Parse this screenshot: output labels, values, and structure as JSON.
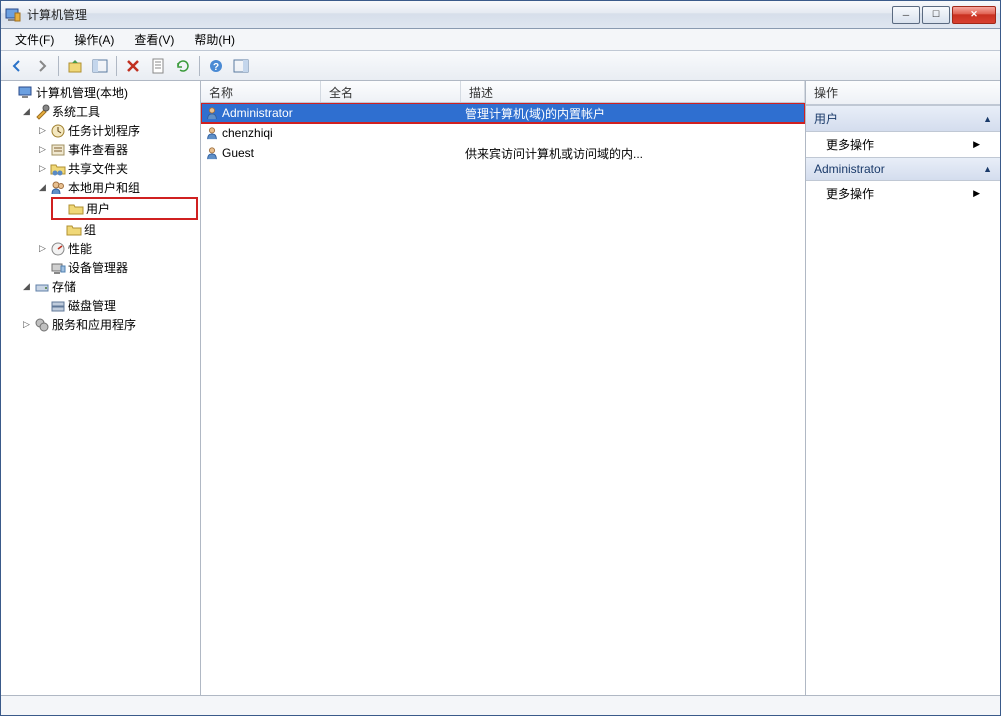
{
  "window": {
    "title": "计算机管理"
  },
  "menu": {
    "file": "文件(F)",
    "action": "操作(A)",
    "view": "查看(V)",
    "help": "帮助(H)"
  },
  "tree": {
    "root": "计算机管理(本地)",
    "system_tools": "系统工具",
    "task_scheduler": "任务计划程序",
    "event_viewer": "事件查看器",
    "shared_folders": "共享文件夹",
    "local_users_groups": "本地用户和组",
    "users": "用户",
    "groups": "组",
    "performance": "性能",
    "device_manager": "设备管理器",
    "storage": "存储",
    "disk_management": "磁盘管理",
    "services_apps": "服务和应用程序"
  },
  "list": {
    "columns": {
      "name": "名称",
      "fullname": "全名",
      "description": "描述"
    },
    "rows": [
      {
        "name": "Administrator",
        "fullname": "",
        "description": "管理计算机(域)的内置帐户",
        "selected": true,
        "highlight": true
      },
      {
        "name": "chenzhiqi",
        "fullname": "",
        "description": "",
        "selected": false,
        "highlight": false
      },
      {
        "name": "Guest",
        "fullname": "",
        "description": "供来宾访问计算机或访问域的内...",
        "selected": false,
        "highlight": false
      }
    ]
  },
  "actions": {
    "header": "操作",
    "section1": "用户",
    "more_actions": "更多操作",
    "section2": "Administrator"
  }
}
